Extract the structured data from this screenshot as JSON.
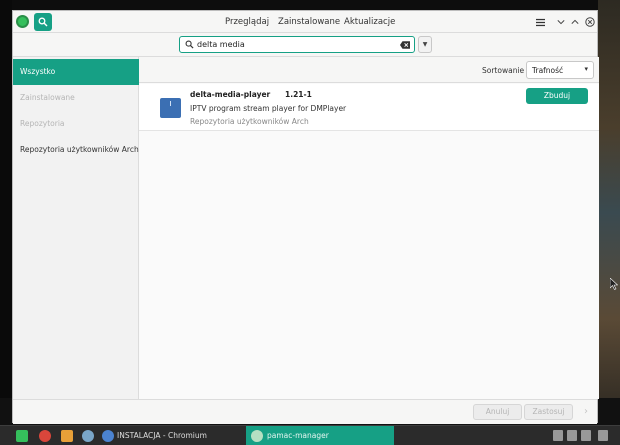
{
  "titlebar": {
    "tabs": [
      {
        "label": "Przeglądaj"
      },
      {
        "label": "Zainstalowane"
      },
      {
        "label": "Aktualizacje"
      }
    ]
  },
  "search": {
    "value": "delta media"
  },
  "sidebar": {
    "items": [
      {
        "label": "Wszystko",
        "state": "active"
      },
      {
        "label": "Zainstalowane",
        "state": "disabled"
      },
      {
        "label": "Repozytoria",
        "state": "disabled"
      },
      {
        "label": "Repozytoria użytkowników Arch",
        "state": "normal"
      }
    ]
  },
  "sort": {
    "label": "Sortowanie",
    "value": "Trafność"
  },
  "packages": [
    {
      "name": "delta-media-player",
      "version": "1.21-1",
      "description": "IPTV program stream player for DMPlayer",
      "repository": "Repozytoria użytkowników Arch",
      "action_label": "Zbuduj"
    }
  ],
  "footer": {
    "cancel_label": "Anuluj",
    "apply_label": "Zastosuj"
  },
  "taskbar": {
    "windows": [
      {
        "label": "INSTALACJA - Chromium"
      },
      {
        "label": "pamac-manager"
      }
    ]
  },
  "colors": {
    "accent": "#16a085",
    "sidebar_bg": "#f2f2f2",
    "disabled_text": "#b5b5b5"
  },
  "icons": {
    "app": "pamac-logo-icon",
    "search_toggle": "search-icon",
    "menu": "hamburger-menu-icon",
    "package": "package-icon"
  }
}
